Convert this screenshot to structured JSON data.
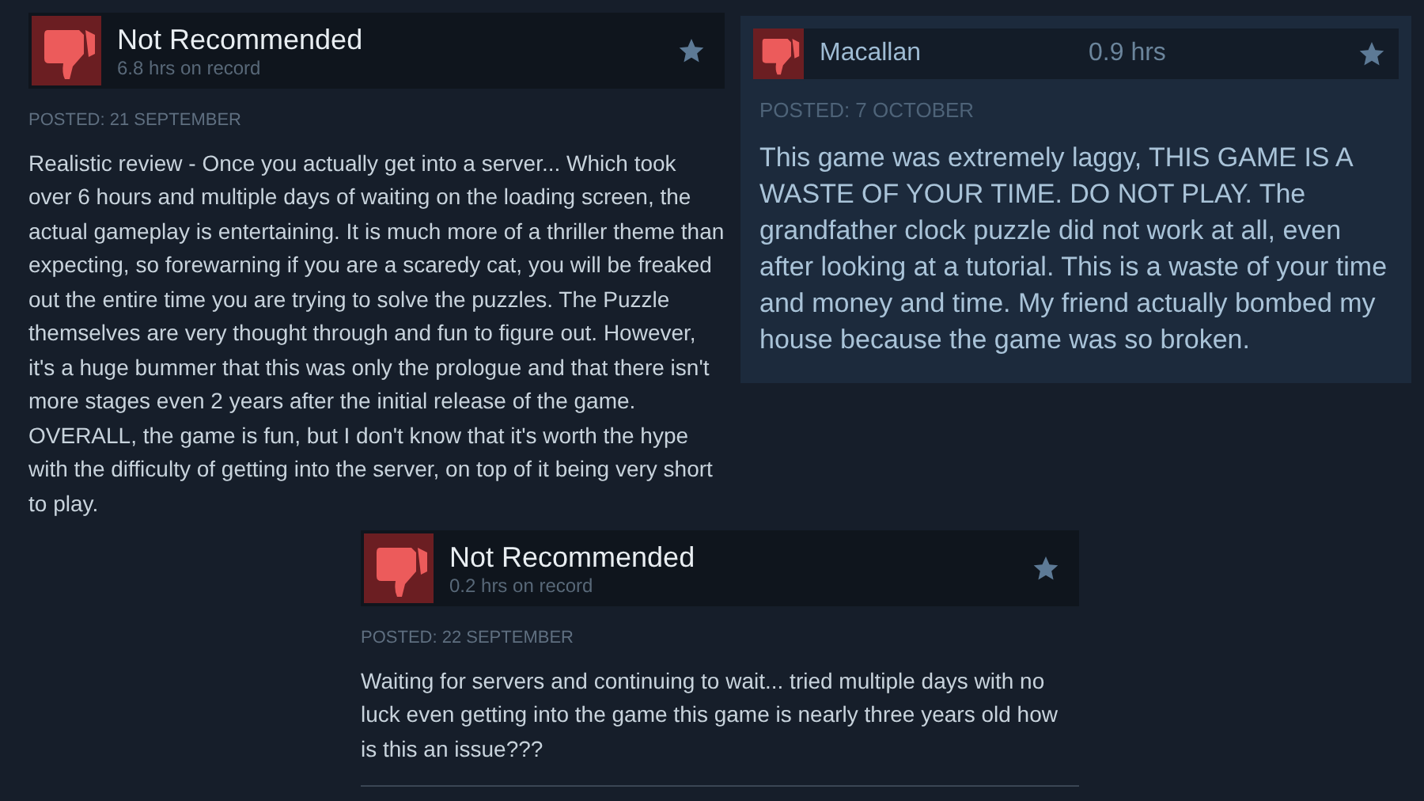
{
  "reviews": [
    {
      "kind": "full",
      "title": "Not Recommended",
      "hours": "6.8 hrs on record",
      "posted": "POSTED: 21 SEPTEMBER",
      "text": "Realistic review - Once you actually get into a server... Which took over 6 hours and multiple days of waiting on the loading screen, the actual gameplay is entertaining. It is much more of a thriller theme than expecting, so forewarning if you are a scaredy cat, you will be freaked out the entire time you are trying to solve the puzzles. The Puzzle themselves are very thought through and fun to figure out. However, it's a huge bummer that this was only the prologue and that there isn't more stages even 2 years after the initial release of the game. OVERALL, the game is fun, but I don't know that it's worth the hype with the difficulty of getting into the server, on top of it being very short to play."
    },
    {
      "kind": "compact",
      "title": "Macallan",
      "hours": "0.9 hrs",
      "posted": "POSTED: 7 OCTOBER",
      "text": "This game was extremely laggy, THIS GAME IS A WASTE OF YOUR TIME. DO NOT PLAY. The grandfather clock puzzle did not work at all, even after looking at a tutorial. This is a waste of your time and money and time. My friend actually bombed my house because the game was so broken."
    },
    {
      "kind": "full",
      "title": "Not Recommended",
      "hours": "0.2 hrs on record",
      "posted": "POSTED: 22 SEPTEMBER",
      "text": "Waiting for servers and continuing to wait... tried multiple days with no luck even getting into the game this game is nearly three years old how is this an issue???"
    }
  ]
}
